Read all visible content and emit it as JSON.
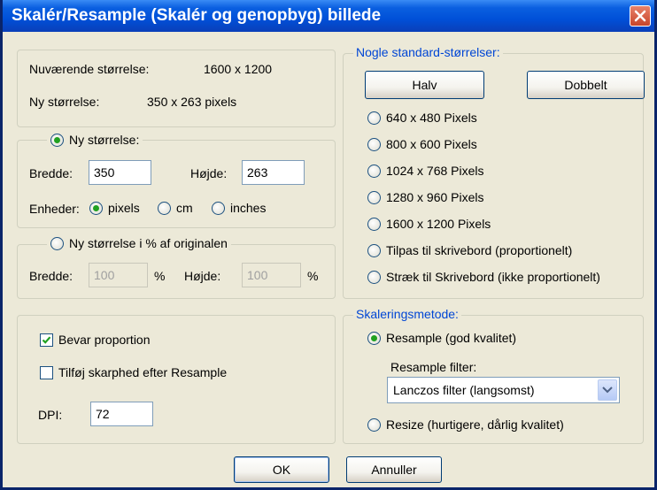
{
  "window": {
    "title": "Skalér/Resample (Skalér og genopbyg) billede"
  },
  "info": {
    "current_label": "Nuværende størrelse:",
    "current_value": "1600  x  1200",
    "new_label": "Ny størrelse:",
    "new_value": "350  x  263  pixels"
  },
  "new_size": {
    "radio_label": "Ny størrelse:",
    "width_label": "Bredde:",
    "width_value": "350",
    "height_label": "Højde:",
    "height_value": "263",
    "units_label": "Enheder:",
    "unit_pixels": "pixels",
    "unit_cm": "cm",
    "unit_inches": "inches"
  },
  "percent": {
    "radio_label": "Ny størrelse i % af originalen",
    "width_label": "Bredde:",
    "width_value": "100",
    "height_label": "Højde:",
    "height_value": "100",
    "pct_symbol": "%"
  },
  "options": {
    "keep_proportion": "Bevar proportion",
    "sharpen": "Tilføj skarphed efter Resample",
    "dpi_label": "DPI:",
    "dpi_value": "72"
  },
  "standard": {
    "legend": "Nogle standard-størrelser:",
    "half": "Halv",
    "double": "Dobbelt",
    "sizes": [
      "640 x 480 Pixels",
      "800 x 600 Pixels",
      "1024 x 768 Pixels",
      "1280 x 960 Pixels",
      "1600 x 1200 Pixels",
      "Tilpas til skrivebord (proportionelt)",
      "Stræk til Skrivebord (ikke proportionelt)"
    ]
  },
  "method": {
    "legend": "Skaleringsmetode:",
    "resample": "Resample (god kvalitet)",
    "filter_label": "Resample filter:",
    "filter_value": "Lanczos filter (langsomst)",
    "resize": "Resize (hurtigere, dårlig kvalitet)"
  },
  "buttons": {
    "ok": "OK",
    "cancel": "Annuller"
  }
}
